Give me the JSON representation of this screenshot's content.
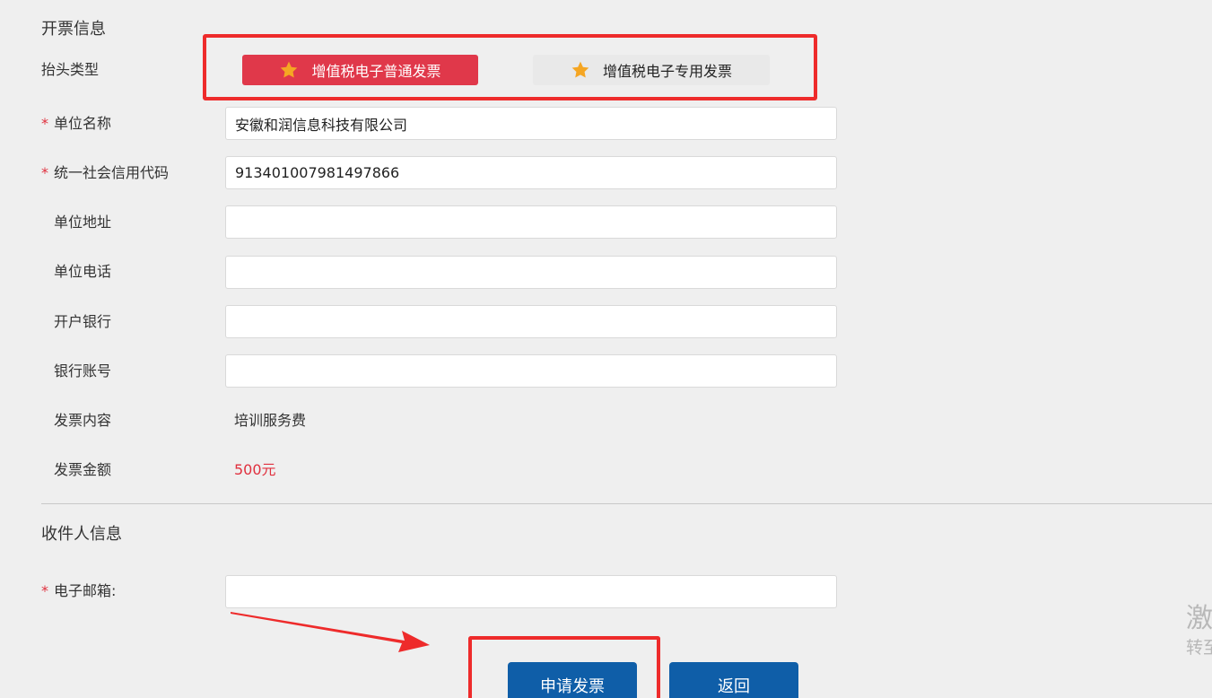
{
  "invoice_section": {
    "title": "开票信息"
  },
  "header_type": {
    "label": "抬头类型",
    "options": [
      {
        "label": "增值税电子普通发票",
        "selected": true
      },
      {
        "label": "增值税电子专用发票",
        "selected": false
      }
    ]
  },
  "fields": {
    "company_name": {
      "label": "单位名称",
      "value": "安徽和润信息科技有限公司"
    },
    "credit_code": {
      "label": "统一社会信用代码",
      "value": "913401007981497866"
    },
    "company_address": {
      "label": "单位地址",
      "value": ""
    },
    "company_phone": {
      "label": "单位电话",
      "value": ""
    },
    "bank": {
      "label": "开户银行",
      "value": ""
    },
    "bank_account": {
      "label": "银行账号",
      "value": ""
    }
  },
  "invoice_content": {
    "label": "发票内容",
    "value": "培训服务费"
  },
  "invoice_amount": {
    "label": "发票金额",
    "value": "500元"
  },
  "recipient_section": {
    "title": "收件人信息"
  },
  "email": {
    "label": "电子邮箱:",
    "value": ""
  },
  "actions": {
    "submit_label": "申请发票",
    "back_label": "返回"
  },
  "watermark": {
    "line1": "激",
    "line2": "转至"
  },
  "colors": {
    "accent_red": "#e0384a",
    "primary_blue": "#0f5ea8",
    "annotation_red": "#ee2b2b",
    "star_yellow": "#f5a623"
  },
  "required_mark": "*"
}
